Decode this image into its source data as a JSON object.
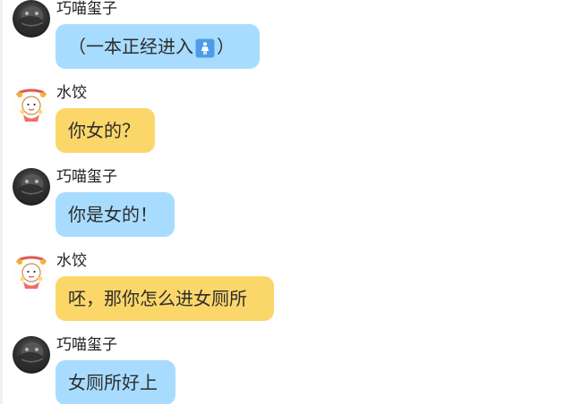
{
  "chat": {
    "messages": [
      {
        "sender": "巧喵玺子",
        "bubble_style": "blue",
        "avatar_icon": "dark-avatar-icon",
        "text_before": "（一本正经进入",
        "emoji": "womens-room-icon",
        "text_after": "）"
      },
      {
        "sender": "水饺",
        "bubble_style": "yellow",
        "avatar_icon": "cartoon-avatar-icon",
        "text": "你女的？"
      },
      {
        "sender": "巧喵玺子",
        "bubble_style": "blue",
        "avatar_icon": "dark-avatar-icon",
        "text": "你是女的！"
      },
      {
        "sender": "水饺",
        "bubble_style": "yellow",
        "avatar_icon": "cartoon-avatar-icon",
        "text": "呸，那你怎么进女厕所"
      },
      {
        "sender": "巧喵玺子",
        "bubble_style": "blue",
        "avatar_icon": "dark-avatar-icon",
        "text": "女厕所好上"
      }
    ]
  },
  "colors": {
    "blue_bubble": "#a8dcff",
    "yellow_bubble": "#fbd76a",
    "text": "#2d2d2d",
    "sender_name": "#1f1f1f",
    "restroom_icon": "#4e9be9"
  }
}
